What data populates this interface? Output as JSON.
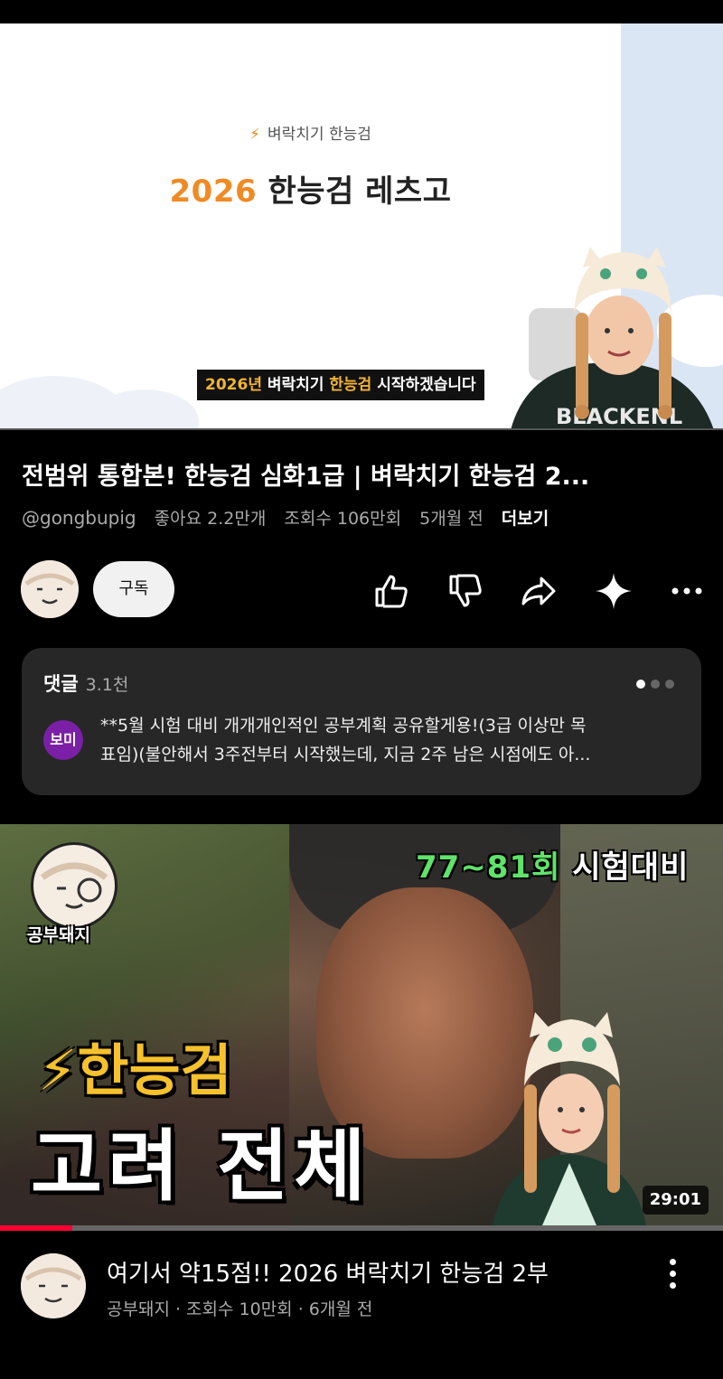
{
  "player": {
    "slide_kicker": "벼락치기 한능검",
    "slide_title_year": "2026",
    "slide_title_rest": " 한능검 레츠고",
    "caption_year": "2026년",
    "caption_mid": " 벼락치기 ",
    "caption_hl": "한능검",
    "caption_end": " 시작하겠습니다"
  },
  "video": {
    "title": "전범위 통합본! 한능검 심화1급 | 벼락치기 한능검 2...",
    "channel": "@gongbupig",
    "likes": "좋아요 2.2만개",
    "views": "조회수 106만회",
    "age": "5개월 전",
    "more": "더보기"
  },
  "actions": {
    "subscribe": "구독",
    "icons": [
      "like-icon",
      "dislike-icon",
      "share-icon",
      "sparkle-icon",
      "more-icon"
    ]
  },
  "comments": {
    "label": "댓글",
    "count": "3.1천",
    "avatar_text": "보미",
    "line1": "**5월 시험 대비 개개개인적인 공부계획 공유할게용!(3급 이상만 목",
    "line2": "표임)(불안해서 3주전부터 시작했는데, 지금 2주 남은 시점에도 아..."
  },
  "next_video": {
    "brand": "공부돼지",
    "exam_num": "77~81회",
    "exam_text": " 시험대비",
    "big_line1": "⚡한능검",
    "big_line2": "고려 전체",
    "duration": "29:01",
    "progress": 0.1,
    "title": "여기서 약15점!! 2026 벼락치기 한능검 2부",
    "meta": "공부돼지 · 조회수 10만회 · 6개월 전"
  },
  "colors": {
    "accent_orange": "#f08a24",
    "progress_red": "#ff0033",
    "exam_green": "#5fe36a",
    "headline_yellow": "#f6c12c"
  }
}
